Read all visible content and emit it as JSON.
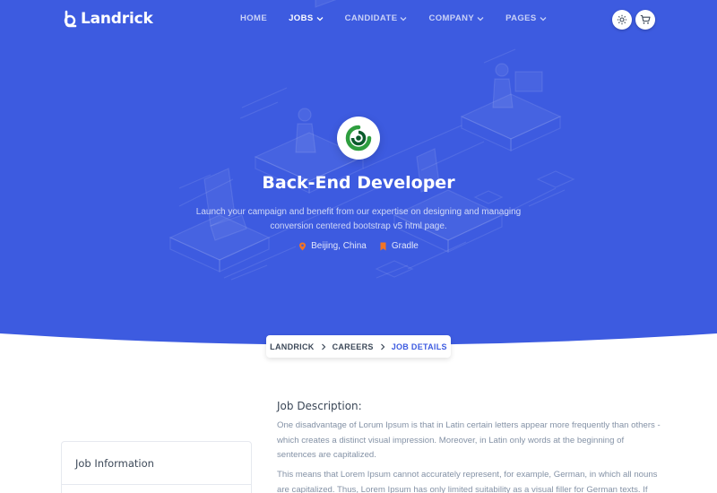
{
  "brand": {
    "name": "Landrick"
  },
  "nav": {
    "items": [
      {
        "label": "HOME",
        "has_dropdown": false,
        "active": false
      },
      {
        "label": "JOBS",
        "has_dropdown": true,
        "active": true
      },
      {
        "label": "CANDIDATE",
        "has_dropdown": true,
        "active": false
      },
      {
        "label": "COMPANY",
        "has_dropdown": true,
        "active": false
      },
      {
        "label": "PAGES",
        "has_dropdown": true,
        "active": false
      }
    ],
    "actions": [
      {
        "icon": "gear-icon"
      },
      {
        "icon": "cart-icon"
      }
    ]
  },
  "hero": {
    "title": "Back-End Developer",
    "subtitle": "Launch your campaign and benefit from our expertise on designing and managing conversion centered bootstrap v5 html page.",
    "location": "Beijing, China",
    "company": "Gradle",
    "location_icon": "map-pin-icon",
    "company_icon": "bookmark-icon"
  },
  "breadcrumb": {
    "items": [
      "LANDRICK",
      "CAREERS"
    ],
    "current": "JOB DETAILS"
  },
  "sidebar": {
    "card_title": "Job Information"
  },
  "main": {
    "heading": "Job Description:",
    "paragraphs": [
      "One disadvantage of Lorum Ipsum is that in Latin certain letters appear more frequently than others - which creates a distinct visual impression. Moreover, in Latin only words at the beginning of sentences are capitalized.",
      "This means that Lorem Ipsum cannot accurately represent, for example, German, in which all nouns are capitalized. Thus, Lorem Ipsum has only limited suitability as a visual filler for German texts. If"
    ]
  },
  "colors": {
    "primary": "#3d5be0",
    "text_dark": "#3c4858",
    "text_muted": "#8492a6",
    "logo_green": "#2e9e3f",
    "logo_dark": "#0b5b2c",
    "pin_orange": "#f17425"
  }
}
